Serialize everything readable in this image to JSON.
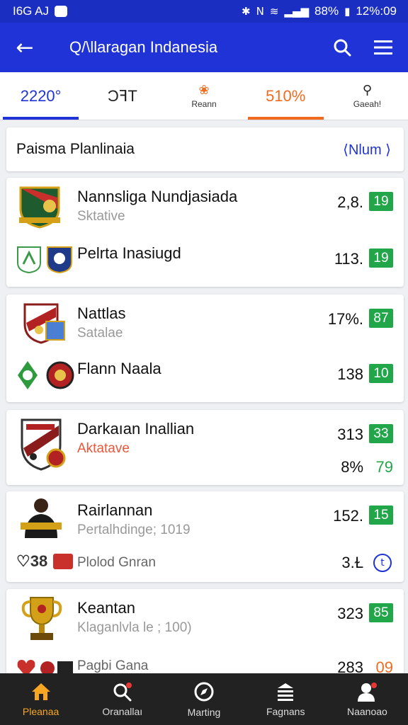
{
  "status": {
    "time": "I6G AJ",
    "battery": "88%",
    "clock": "12%:09"
  },
  "appbar": {
    "title": "Q/\\llaragan Indanesia"
  },
  "tabs": [
    {
      "label": "2220°",
      "sub": ""
    },
    {
      "label": "ƆꟻT",
      "sub": ""
    },
    {
      "label": "",
      "sub": "Reann"
    },
    {
      "label": "510%",
      "sub": ""
    },
    {
      "label": "",
      "sub": "Gaeah!"
    }
  ],
  "section": {
    "title": "Paisma Planlinaia",
    "link": "⟨Nlum ⟩"
  },
  "cards": [
    {
      "rows": [
        {
          "title": "Nannsliga Nundjasiada",
          "sub": "Sktative",
          "num": "2,8.",
          "badge": "19"
        },
        {
          "title": "Pelrta Inasiugd",
          "sub": "",
          "num": "113.",
          "badge": "19"
        }
      ]
    },
    {
      "rows": [
        {
          "title": "Nattlas",
          "sub": "Satalae",
          "num": "17%.",
          "badge": "87"
        },
        {
          "title": "Flann Naala",
          "sub": "",
          "num": "138",
          "badge": "10"
        }
      ]
    },
    {
      "rows": [
        {
          "title": "Darkaıan Inallian",
          "sub": "Aktatave",
          "num": "313",
          "badge": "33"
        },
        {
          "title": "",
          "sub": "",
          "num": "8%",
          "badge": "79"
        }
      ]
    },
    {
      "rows": [
        {
          "title": "Rairlannan",
          "sub": "Pertalhdinge; 1019",
          "num": "152.",
          "badge": "15"
        },
        {
          "title": "Plolod Gnran",
          "sub": "♡38",
          "num": "3.Ɫ",
          "badge": "t"
        }
      ]
    },
    {
      "rows": [
        {
          "title": "Keantan",
          "sub": "Klaganlvla le ; 100)",
          "num": "323",
          "badge": "85"
        },
        {
          "title": "Pagbi Gana",
          "sub": "",
          "num": "283",
          "badge": "09"
        }
      ]
    }
  ],
  "bottomnav": [
    {
      "label": "Pleanaa",
      "icon": "home-icon"
    },
    {
      "label": "Oranallaı",
      "icon": "search-icon"
    },
    {
      "label": "Marting",
      "icon": "compass-icon"
    },
    {
      "label": "Fagnans",
      "icon": "list-icon"
    },
    {
      "label": "Naanoao",
      "icon": "profile-icon"
    }
  ],
  "colors": {
    "primary": "#1f33d6",
    "accent": "#f06b1f",
    "badge": "#22a64a",
    "nav_active": "#f6a623"
  }
}
